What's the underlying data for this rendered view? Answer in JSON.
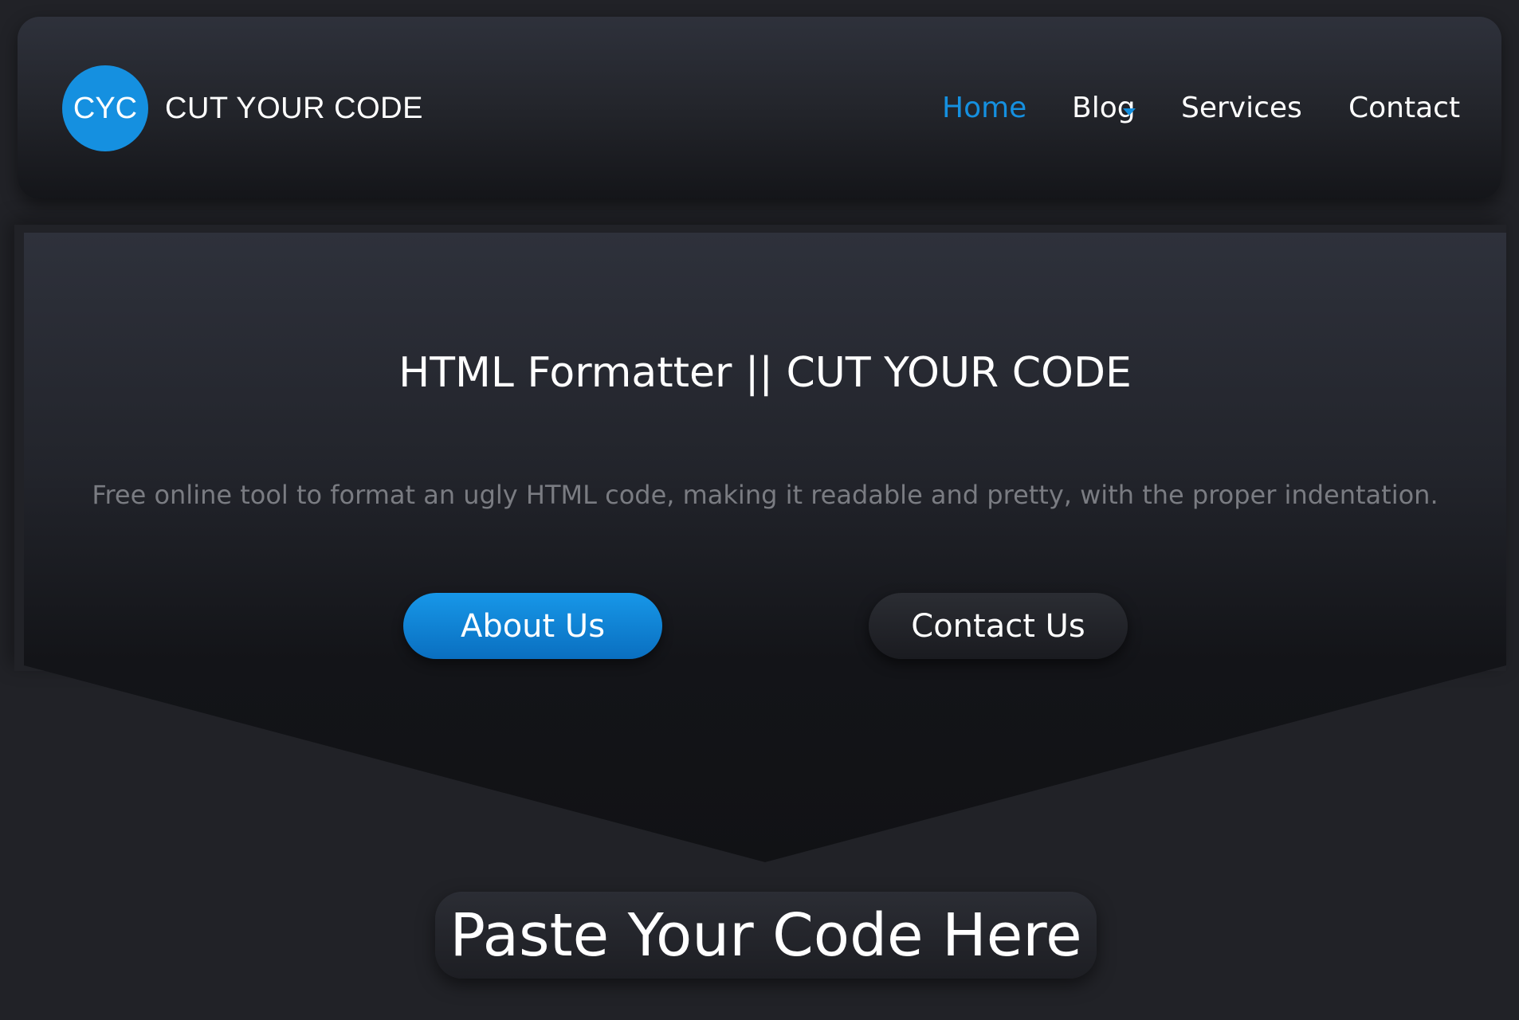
{
  "header": {
    "logo_text": "CYC",
    "brand": "CUT YOUR CODE",
    "nav": {
      "home": "Home",
      "blog": "Blog",
      "services": "Services",
      "contact": "Contact"
    },
    "active_nav": "home",
    "accent_color": "#1590e0"
  },
  "hero": {
    "title": "HTML Formatter || CUT YOUR CODE",
    "description": "Free online tool to format an ugly HTML code, making it readable and pretty, with the proper indentation.",
    "about_button": "About Us",
    "contact_button": "Contact Us"
  },
  "main": {
    "paste_heading": "Paste Your Code Here"
  },
  "icons": {
    "blog_dropdown": "caret-down-icon"
  }
}
